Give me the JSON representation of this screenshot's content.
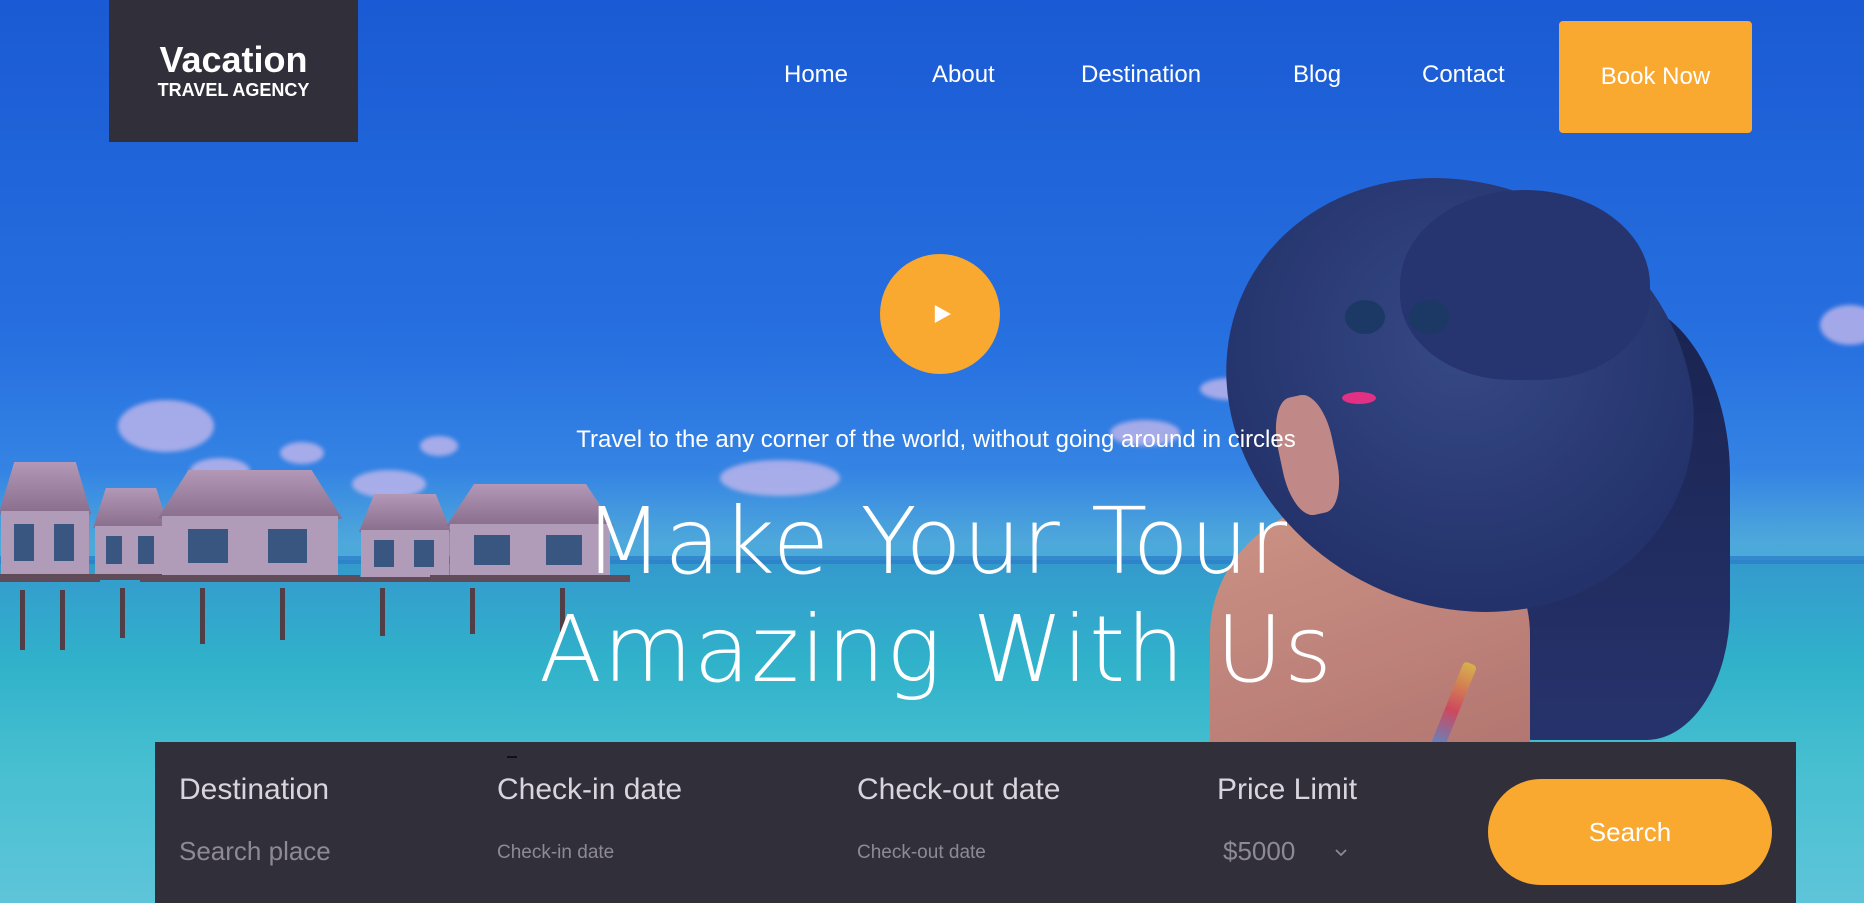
{
  "brand": {
    "name": "Vacation",
    "subtitle": "TRAVEL AGENCY"
  },
  "nav": {
    "items": [
      {
        "label": "Home"
      },
      {
        "label": "About"
      },
      {
        "label": "Destination"
      },
      {
        "label": "Blog"
      },
      {
        "label": "Contact"
      }
    ],
    "cta_label": "Book Now"
  },
  "hero": {
    "play_icon": "play-icon",
    "tagline": "Travel to the any corner of the world, without going around in circles",
    "headline_line1": "Make Your Tour",
    "headline_line2": "Amazing With Us"
  },
  "search": {
    "destination": {
      "label": "Destination",
      "placeholder": "Search place"
    },
    "checkin": {
      "label": "Check-in date",
      "placeholder": "Check-in date"
    },
    "checkout": {
      "label": "Check-out date",
      "placeholder": "Check-out date"
    },
    "price": {
      "label": "Price Limit",
      "value": "$5000"
    },
    "button_label": "Search"
  },
  "colors": {
    "accent": "#f9a830",
    "dark_panel": "#312f3a",
    "sky": "#1f66d9",
    "sea": "#3fc6d0"
  }
}
